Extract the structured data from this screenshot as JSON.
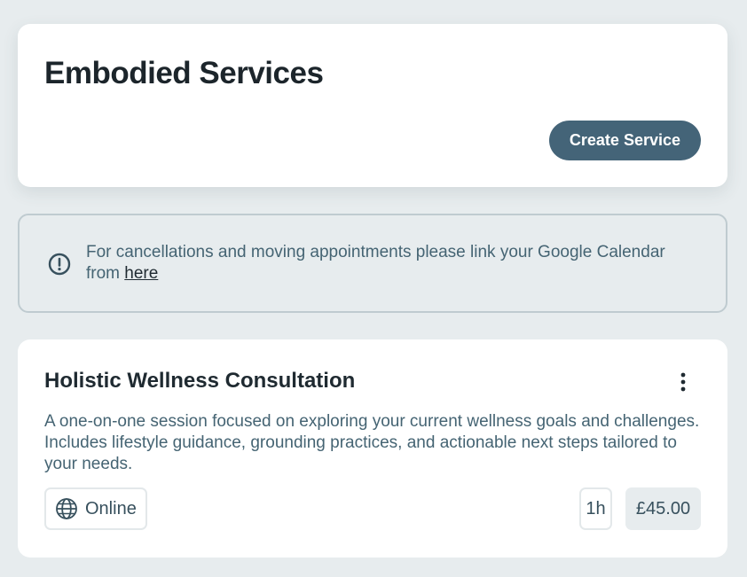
{
  "header": {
    "title": "Embodied Services",
    "create_button_label": "Create Service"
  },
  "notice": {
    "icon": "alert-circle-icon",
    "text": "For cancellations and moving appointments please link your Google Calendar from ",
    "link_label": "here"
  },
  "service": {
    "title": "Holistic Wellness Consultation",
    "description": "A one-on-one session focused on exploring your current wellness goals and challenges. Includes lifestyle guidance, grounding practices, and actionable next steps tailored to your needs.",
    "location_icon": "globe-icon",
    "location_label": "Online",
    "duration": "1h",
    "price": "£45.00"
  },
  "colors": {
    "background": "#e7ecee",
    "primary_button": "#446478",
    "muted_text": "#456473",
    "heading_text": "#1c252b"
  }
}
